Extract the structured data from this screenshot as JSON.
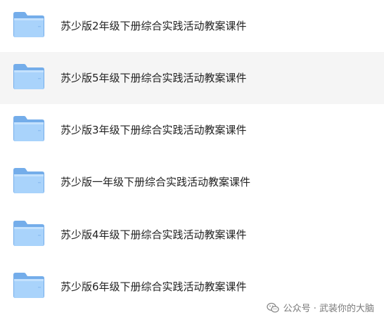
{
  "folders": [
    {
      "label": "苏少版2年级下册综合实践活动教案课件",
      "icon": "folder-icon",
      "selected": false
    },
    {
      "label": "苏少版5年级下册综合实践活动教案课件",
      "icon": "folder-icon",
      "selected": true
    },
    {
      "label": "苏少版3年级下册综合实践活动教案课件",
      "icon": "folder-icon",
      "selected": false
    },
    {
      "label": "苏少版一年级下册综合实践活动教案课件",
      "icon": "folder-icon",
      "selected": false
    },
    {
      "label": "苏少版4年级下册综合实践活动教案课件",
      "icon": "folder-icon",
      "selected": false
    },
    {
      "label": "苏少版6年级下册综合实践活动教案课件",
      "icon": "folder-icon",
      "selected": false
    }
  ],
  "watermark": {
    "icon": "wechat-icon",
    "text": "公众号 · 武装你的大脑"
  },
  "colors": {
    "folder_back": "#74ADEA",
    "folder_front": "#A9D3FB",
    "folder_tab": "#8FC0F3",
    "selected_row": "#F5F5F5",
    "label_text": "#222222",
    "watermark_text": "#7A7A7A"
  }
}
